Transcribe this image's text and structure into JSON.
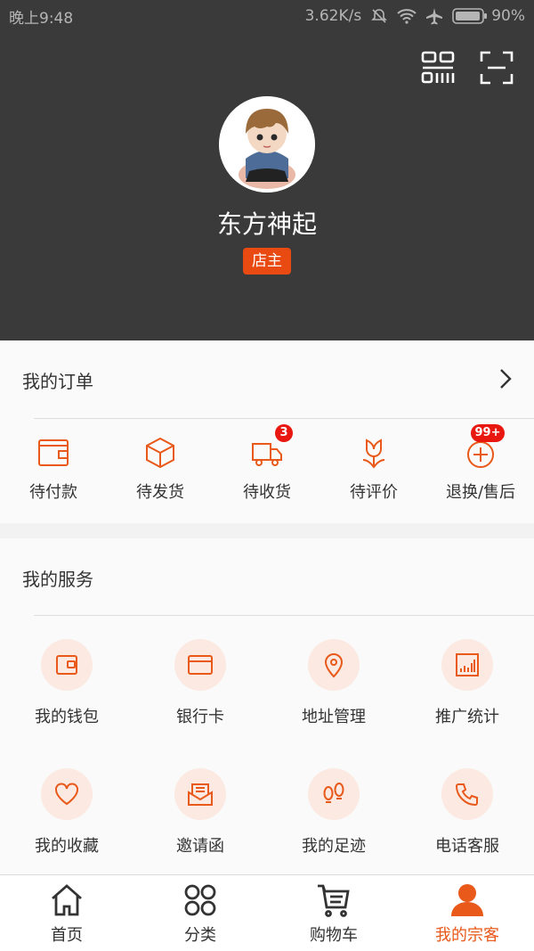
{
  "status_bar": {
    "time": "晚上9:48",
    "speed": "3.62K/s",
    "battery": "90%"
  },
  "profile": {
    "username": "东方神起",
    "role_badge": "店主"
  },
  "orders": {
    "title": "我的订单",
    "items": [
      {
        "label": "待付款",
        "icon": "wallet-icon"
      },
      {
        "label": "待发货",
        "icon": "box-icon"
      },
      {
        "label": "待收货",
        "icon": "truck-icon",
        "badge": "3"
      },
      {
        "label": "待评价",
        "icon": "flower-icon"
      },
      {
        "label": "退换/售后",
        "icon": "return-icon",
        "badge": "99+"
      }
    ]
  },
  "services": {
    "title": "我的服务",
    "items": [
      {
        "label": "我的钱包",
        "icon": "wallet-icon"
      },
      {
        "label": "银行卡",
        "icon": "bank-card-icon"
      },
      {
        "label": "地址管理",
        "icon": "location-pin-icon"
      },
      {
        "label": "推广统计",
        "icon": "stats-icon"
      },
      {
        "label": "我的收藏",
        "icon": "heart-icon"
      },
      {
        "label": "邀请函",
        "icon": "envelope-icon"
      },
      {
        "label": "我的足迹",
        "icon": "footprints-icon"
      },
      {
        "label": "电话客服",
        "icon": "phone-icon"
      }
    ]
  },
  "tabbar": {
    "items": [
      {
        "label": "首页",
        "icon": "home-icon"
      },
      {
        "label": "分类",
        "icon": "category-icon"
      },
      {
        "label": "购物车",
        "icon": "cart-icon"
      },
      {
        "label": "我的宗客",
        "icon": "person-icon",
        "active": true
      }
    ]
  },
  "colors": {
    "accent": "#e8591a",
    "header_bg": "#3a3a3a",
    "badge_red": "#e8170f",
    "icon_circle": "#fbe9e2"
  }
}
